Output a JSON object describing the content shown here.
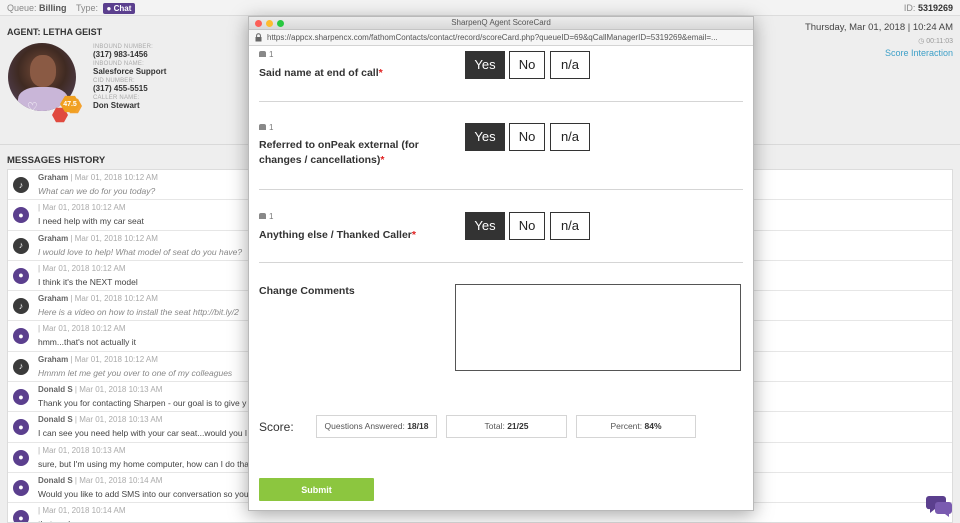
{
  "topbar": {
    "queue_label": "Queue:",
    "queue_value": "Billing",
    "type_label": "Type:",
    "type_value": "Chat",
    "id_label": "ID:",
    "id_value": "5319269"
  },
  "agent": {
    "title": "AGENT: LETHA GEIST",
    "level": "47.5",
    "fields": [
      {
        "label": "INBOUND NUMBER:",
        "value": "(317) 983-1456"
      },
      {
        "label": "INBOUND NAME:",
        "value": "Salesforce Support"
      },
      {
        "label": "CID NUMBER:",
        "value": "(317) 455-5515"
      },
      {
        "label": "CALLER NAME:",
        "value": "Don Stewart"
      }
    ]
  },
  "header_right": {
    "datetime": "Thursday, Mar 01, 2018 | 10:24 AM",
    "timer": "00:11:03",
    "score_link": "Score Interaction"
  },
  "messages": {
    "title": "MESSAGES HISTORY",
    "items": [
      {
        "kind": "bot",
        "author": "Graham",
        "sep": " | ",
        "time": "Mar 01, 2018 10:12 AM",
        "text": "What can we do for you today?",
        "italic": true
      },
      {
        "kind": "cust",
        "author": "",
        "sep": "| ",
        "time": "Mar 01, 2018 10:12 AM",
        "text": "I need help with my car seat",
        "italic": false
      },
      {
        "kind": "bot",
        "author": "Graham",
        "sep": " | ",
        "time": "Mar 01, 2018 10:12 AM",
        "text": "I would love to help! What model of seat do you have?",
        "italic": true
      },
      {
        "kind": "cust",
        "author": "",
        "sep": "| ",
        "time": "Mar 01, 2018 10:12 AM",
        "text": "I think it's the NEXT model",
        "italic": false
      },
      {
        "kind": "bot",
        "author": "Graham",
        "sep": " | ",
        "time": "Mar 01, 2018 10:12 AM",
        "text": "Here is a video on how to install the seat http://bit.ly/2",
        "italic": true
      },
      {
        "kind": "cust",
        "author": "",
        "sep": "| ",
        "time": "Mar 01, 2018 10:12 AM",
        "text": "hmm...that's not actually it",
        "italic": false
      },
      {
        "kind": "bot",
        "author": "Graham",
        "sep": " | ",
        "time": "Mar 01, 2018 10:12 AM",
        "text": "Hmmm let me get you over to one of my colleagues",
        "italic": true
      },
      {
        "kind": "cust",
        "author": "Donald S",
        "sep": " | ",
        "time": "Mar 01, 2018 10:13 AM",
        "text": "Thank you for contacting Sharpen - our goal is to give y",
        "italic": false
      },
      {
        "kind": "cust",
        "author": "Donald S",
        "sep": " | ",
        "time": "Mar 01, 2018 10:13 AM",
        "text": "I can see you need help with your car seat...would you l",
        "italic": false
      },
      {
        "kind": "cust",
        "author": "",
        "sep": "| ",
        "time": "Mar 01, 2018 10:13 AM",
        "text": "sure, but I'm using my home computer, how can I do tha",
        "italic": false
      },
      {
        "kind": "cust",
        "author": "Donald S",
        "sep": " | ",
        "time": "Mar 01, 2018 10:14 AM",
        "text": "Would you like to add SMS into our conversation so you",
        "italic": false
      },
      {
        "kind": "cust",
        "author": "",
        "sep": "| ",
        "time": "Mar 01, 2018 10:14 AM",
        "text": "that works",
        "italic": false
      }
    ]
  },
  "modal": {
    "window_title": "SharpenQ Agent ScoreCard",
    "url": "https://appcx.sharpencx.com/fathomContacts/contact/record/scoreCard.php?queueID=69&qCallManagerID=5319269&email=...",
    "questions": [
      {
        "weight": "1",
        "text": "Said name at end of call",
        "required_mark": "*",
        "selected": "yes",
        "options": {
          "yes": "Yes",
          "no": "No",
          "na": "n/a"
        }
      },
      {
        "weight": "1",
        "text": "Referred to onPeak external (for changes / cancellations)",
        "required_mark": "*",
        "selected": "yes",
        "options": {
          "yes": "Yes",
          "no": "No",
          "na": "n/a"
        }
      },
      {
        "weight": "1",
        "text": "Anything else / Thanked Caller",
        "required_mark": "*",
        "selected": "yes",
        "options": {
          "yes": "Yes",
          "no": "No",
          "na": "n/a"
        }
      }
    ],
    "comments_label": "Change Comments",
    "comments_value": "",
    "score": {
      "label": "Score:",
      "questions_answered_label": "Questions Answered:",
      "questions_answered_value": "18/18",
      "total_label": "Total:",
      "total_value": "21/25",
      "percent_label": "Percent:",
      "percent_value": "84%"
    },
    "submit_label": "Submit"
  },
  "colors": {
    "brand_purple": "#5b3f8e",
    "link_blue": "#3ea0c8",
    "submit_green": "#8cc63f",
    "required_red": "#e02020"
  },
  "icons": {
    "bot_message": "bell-icon",
    "customer_message": "chat-bubble-icon",
    "chat_launcher": "chat-bubbles-icon"
  }
}
